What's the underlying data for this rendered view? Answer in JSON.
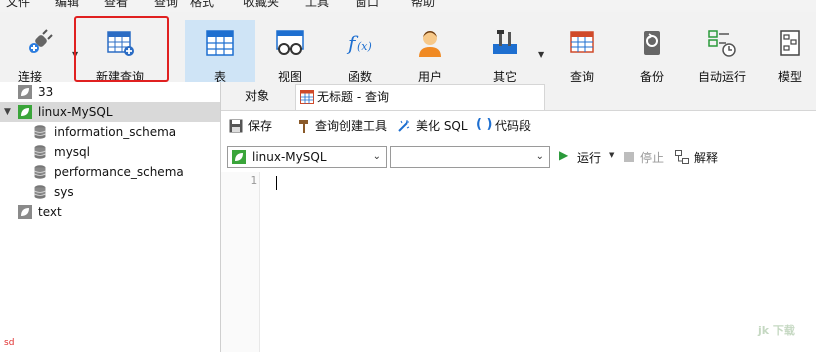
{
  "menu": [
    "文件",
    "编辑",
    "查看",
    "查询",
    "格式",
    "收藏夹",
    "工具",
    "窗口",
    "帮助"
  ],
  "toolbar": {
    "connect": "连接",
    "new_query": "新建查询",
    "table": "表",
    "view": "视图",
    "function": "函数",
    "user": "用户",
    "other": "其它",
    "query": "查询",
    "backup": "备份",
    "autorun": "自动运行",
    "model": "模型"
  },
  "tree": {
    "conn1": "33",
    "conn2": "linux-MySQL",
    "dbs": [
      "information_schema",
      "mysql",
      "performance_schema",
      "sys"
    ],
    "conn3": "text"
  },
  "tabs": {
    "objects": "对象",
    "query_tab": "无标题 - 查询"
  },
  "query_toolbar": {
    "save": "保存",
    "builder": "查询创建工具",
    "beautify": "美化 SQL",
    "snippet": "代码段"
  },
  "selectors": {
    "connection": "linux-MySQL",
    "database": ""
  },
  "run_controls": {
    "run": "运行",
    "stop": "停止",
    "explain": "解释"
  },
  "editor": {
    "line_number": "1"
  },
  "status_text": "sd",
  "watermark": "jk 下载",
  "colors": {
    "accent_blue": "#1e6fd0",
    "active_tab": "#cfe4f6",
    "highlight_red": "#e02020",
    "green_leaf": "#3aa53a"
  }
}
